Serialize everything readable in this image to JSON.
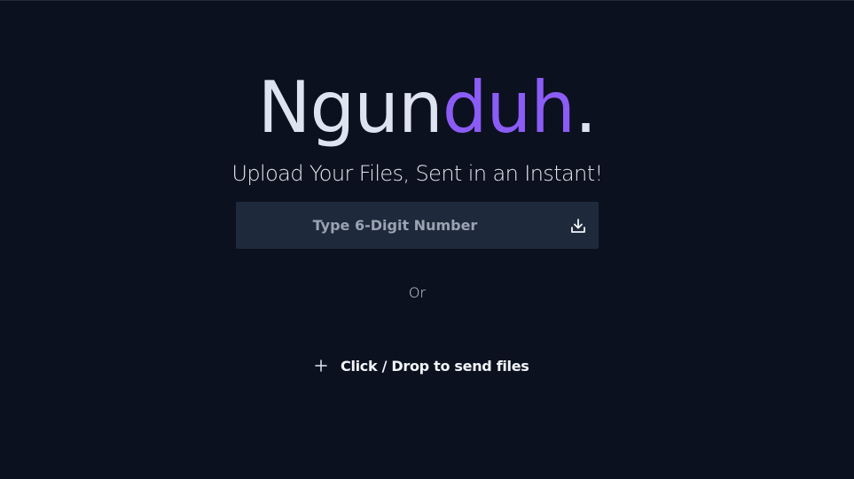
{
  "logo": {
    "part_a": "Ngun",
    "part_b": "duh",
    "part_c": "."
  },
  "tagline": "Upload Your Files, Sent in an Instant!",
  "code_input": {
    "placeholder": "Type 6-Digit Number",
    "value": ""
  },
  "download_icon": "download-icon",
  "or_text": "Or",
  "send_button": {
    "icon": "plus-icon",
    "label": "Click / Drop to send files"
  },
  "colors": {
    "background": "#0c1120",
    "accent": "#8b5cf6",
    "input_bg": "#1e293b",
    "text": "#dde4ef"
  }
}
